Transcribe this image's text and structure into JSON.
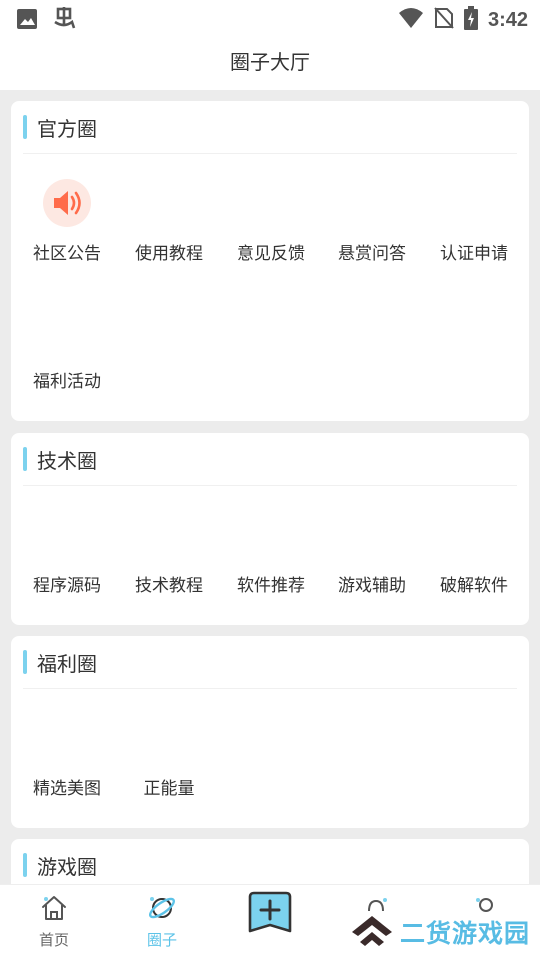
{
  "status_bar": {
    "time": "3:42"
  },
  "header": {
    "title": "圈子大厅"
  },
  "sections": [
    {
      "title": "官方圈",
      "items": [
        {
          "label": "社区公告",
          "icon": "speaker-icon"
        },
        {
          "label": "使用教程"
        },
        {
          "label": "意见反馈"
        },
        {
          "label": "悬赏问答"
        },
        {
          "label": "认证申请"
        },
        {
          "label": "福利活动"
        }
      ]
    },
    {
      "title": "技术圈",
      "items": [
        {
          "label": "程序源码"
        },
        {
          "label": "技术教程"
        },
        {
          "label": "软件推荐"
        },
        {
          "label": "游戏辅助"
        },
        {
          "label": "破解软件"
        }
      ]
    },
    {
      "title": "福利圈",
      "items": [
        {
          "label": "精选美图"
        },
        {
          "label": "正能量"
        }
      ]
    },
    {
      "title": "游戏圈",
      "items": []
    }
  ],
  "bottom_nav": {
    "items": [
      {
        "label": "首页",
        "icon": "home-icon",
        "active": false
      },
      {
        "label": "圈子",
        "icon": "planet-icon",
        "active": true
      },
      {
        "label": "",
        "icon": "add-post-icon",
        "active": false
      },
      {
        "label": "",
        "icon": "bell-icon",
        "active": false
      },
      {
        "label": "",
        "icon": "profile-icon",
        "active": false
      }
    ]
  },
  "watermark": {
    "text": "二货游戏园"
  },
  "colors": {
    "accent": "#5cc3e8",
    "section_bar": "#7cd2ee",
    "speaker_icon": "#ff6b4a"
  }
}
